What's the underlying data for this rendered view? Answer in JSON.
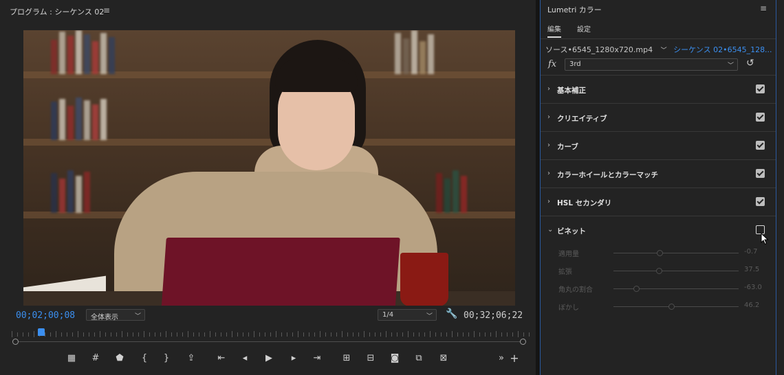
{
  "monitor": {
    "title": "プログラム : シーケンス 02",
    "menu_icon": "hamburger-menu-icon",
    "current_timecode": "00;02;00;08",
    "zoom_level": "全体表示",
    "resolution": "1/4",
    "duration_timecode": "00;32;06;22",
    "playhead_position": 0.05,
    "transport_icons": [
      "add-marker-icon",
      "mark-in-out-icon",
      "marker-icon",
      "mark-in-icon",
      "mark-out-icon",
      "lift-icon",
      "go-to-in-icon",
      "step-back-icon",
      "play-icon",
      "step-forward-icon",
      "go-to-out-icon",
      "insert-icon",
      "overwrite-icon",
      "camera-icon",
      "compare-view-icon",
      "multi-camera-icon",
      "more-icon",
      "add-button-icon"
    ]
  },
  "lumetri": {
    "title": "Lumetri カラー",
    "tabs": [
      {
        "label": "編集",
        "active": true
      },
      {
        "label": "設定",
        "active": false
      }
    ],
    "source_label": "ソース•6545_1280x720.mp4",
    "sequence_label": "シーケンス 02•6545_128...",
    "fx_label": "fx",
    "preset": "3rd",
    "sections": [
      {
        "label": "基本補正",
        "enabled": true,
        "expanded": false
      },
      {
        "label": "クリエイティブ",
        "enabled": true,
        "expanded": false
      },
      {
        "label": "カーブ",
        "enabled": true,
        "expanded": false
      },
      {
        "label": "カラーホイールとカラーマッチ",
        "enabled": true,
        "expanded": false
      },
      {
        "label": "HSL セカンダリ",
        "enabled": true,
        "expanded": false
      },
      {
        "label": "ビネット",
        "enabled": false,
        "expanded": true
      }
    ],
    "vignette_sliders": [
      {
        "label": "適用量",
        "value": "-0.7",
        "pos": 0.37
      },
      {
        "label": "拡張",
        "value": "37.5",
        "pos": 0.36
      },
      {
        "label": "角丸の割合",
        "value": "-63.0",
        "pos": 0.18
      },
      {
        "label": "ぼかし",
        "value": "46.2",
        "pos": 0.46
      }
    ]
  },
  "colors": {
    "accent": "#3b8ff0",
    "panel_bg": "#232323"
  }
}
